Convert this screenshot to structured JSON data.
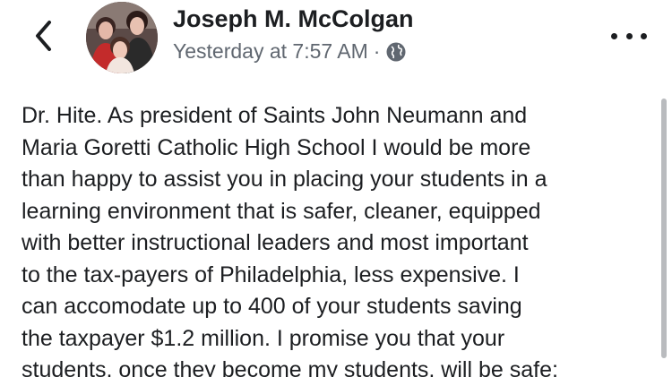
{
  "post": {
    "author": "Joseph M. McColgan",
    "timestamp": "Yesterday at 7:57 AM",
    "separator": "·",
    "privacy_icon": "globe-icon",
    "back_icon": "chevron-left-icon",
    "more_icon": "more-horizontal-icon",
    "text_lines": [
      "Dr. Hite. As president of Saints John Neumann and",
      "Maria Goretti Catholic High School I would be more",
      "than happy to assist you in placing your students in a",
      "learning environment that is safer, cleaner, equipped",
      "with better instructional leaders and most important",
      "to the tax-payers of Philadelphia, less expensive.  I",
      "can accomodate up to 400 of your students saving",
      "the taxpayer $1.2 million. I promise you that your",
      "students, once they become my students, will be safe;"
    ]
  },
  "colors": {
    "text": "#1c1e21",
    "secondary_text": "#606770",
    "background": "#ffffff",
    "scrollbar": "#b9bbbe"
  }
}
